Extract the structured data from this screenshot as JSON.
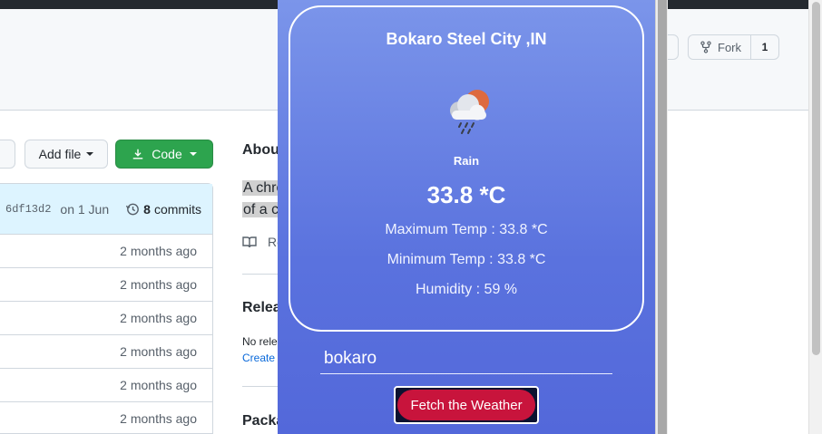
{
  "github": {
    "fork_label": "Fork",
    "fork_count": "1",
    "add_file_label": "Add file",
    "code_label": "Code",
    "commit": {
      "sha": "6df13d2",
      "date": "on 1 Jun",
      "count": "8",
      "commits_label": "commits"
    },
    "file_rows": [
      {
        "age": "2 months ago"
      },
      {
        "age": "2 months ago"
      },
      {
        "age": "2 months ago"
      },
      {
        "age": "2 months ago"
      },
      {
        "age": "2 months ago"
      },
      {
        "age": "2 months ago"
      }
    ],
    "about": {
      "title": "Abou",
      "desc_line1": "A chro",
      "desc_line2": "of a c",
      "readme": "Re"
    },
    "releases": {
      "title": "Relea",
      "none_text": "No rele",
      "create_link": "Create"
    },
    "packages_title": "Packa"
  },
  "weather": {
    "city": "Bokaro Steel City ,IN",
    "icon": "rain-cloud-sun-icon",
    "condition": "Rain",
    "temperature": "33.8 *C",
    "max_temp": "Maximum Temp : 33.8 *C",
    "min_temp": "Minimum Temp : 33.8 *C",
    "humidity": "Humidity : 59 %",
    "input_value": "bokaro",
    "button_label": "Fetch the Weather",
    "colors": {
      "gradient_top": "#7b95ea",
      "gradient_bottom": "#5368da",
      "button": "#c8143c"
    }
  }
}
